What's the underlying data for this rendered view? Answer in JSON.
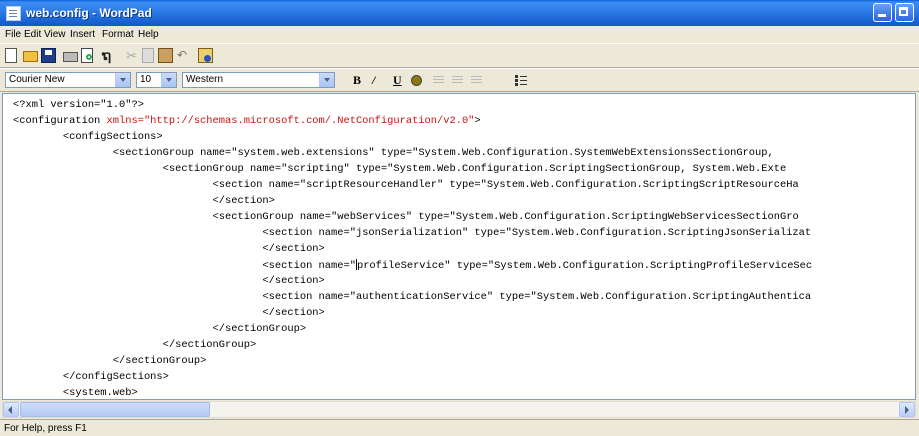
{
  "window": {
    "title": "web.config - WordPad"
  },
  "menu": [
    "File",
    "Edit",
    "View",
    "Insert",
    "Format",
    "Help"
  ],
  "toolbar": {
    "icons": [
      "new-document-icon",
      "open-folder-icon",
      "save-disk-icon",
      "print-icon",
      "print-preview-icon",
      "find-binoculars-icon",
      "cut-scissors-icon",
      "copy-icon",
      "paste-icon",
      "undo-icon",
      "date-time-icon"
    ],
    "find_glyph": "ຖ",
    "cut_glyph": "✂",
    "undo_glyph": "↶"
  },
  "format": {
    "font": "Courier New",
    "size": "10",
    "script": "Western",
    "bold": "B",
    "italic": "/",
    "underline": "U"
  },
  "document": {
    "lines": [
      {
        "indent": "",
        "pre": "<?xml version=\"1.0\"?>",
        "attr": "",
        "post": ""
      },
      {
        "indent": "",
        "pre": "<configuration ",
        "attr": "xmlns=\"http://schemas.microsoft.com/.NetConfiguration/v2.0\"",
        "post": ">"
      },
      {
        "indent": "        ",
        "pre": "<configSections>",
        "attr": "",
        "post": ""
      },
      {
        "indent": "                ",
        "pre": "<sectionGroup name=\"system.web.extensions\" type=\"System.Web.Configuration.SystemWebExtensionsSectionGroup,",
        "attr": "",
        "post": ""
      },
      {
        "indent": "                        ",
        "pre": "<sectionGroup name=\"scripting\" type=\"System.Web.Configuration.ScriptingSectionGroup, System.Web.Exte",
        "attr": "",
        "post": ""
      },
      {
        "indent": "                                ",
        "pre": "<section name=\"scriptResourceHandler\" type=\"System.Web.Configuration.ScriptingScriptResourceHa",
        "attr": "",
        "post": ""
      },
      {
        "indent": "                                ",
        "pre": "</section>",
        "attr": "",
        "post": ""
      },
      {
        "indent": "                                ",
        "pre": "<sectionGroup name=\"webServices\" type=\"System.Web.Configuration.ScriptingWebServicesSectionGro",
        "attr": "",
        "post": ""
      },
      {
        "indent": "                                        ",
        "pre": "<section name=\"jsonSerialization\" type=\"System.Web.Configuration.ScriptingJsonSerializat",
        "attr": "",
        "post": ""
      },
      {
        "indent": "                                        ",
        "pre": "</section>",
        "attr": "",
        "post": ""
      },
      {
        "indent": "                                        ",
        "pre": "<section name=\"",
        "attr": "",
        "post": "profileService\" type=\"System.Web.Configuration.ScriptingProfileServiceSec",
        "caret": true
      },
      {
        "indent": "                                        ",
        "pre": "</section>",
        "attr": "",
        "post": ""
      },
      {
        "indent": "                                        ",
        "pre": "<section name=\"authenticationService\" type=\"System.Web.Configuration.ScriptingAuthentica",
        "attr": "",
        "post": ""
      },
      {
        "indent": "                                        ",
        "pre": "</section>",
        "attr": "",
        "post": ""
      },
      {
        "indent": "                                ",
        "pre": "</sectionGroup>",
        "attr": "",
        "post": ""
      },
      {
        "indent": "                        ",
        "pre": "</sectionGroup>",
        "attr": "",
        "post": ""
      },
      {
        "indent": "                ",
        "pre": "</sectionGroup>",
        "attr": "",
        "post": ""
      },
      {
        "indent": "        ",
        "pre": "</configSections>",
        "attr": "",
        "post": ""
      },
      {
        "indent": "        ",
        "pre": "<system.web>",
        "attr": "",
        "post": ""
      }
    ]
  },
  "status": {
    "text": "For Help, press F1"
  },
  "colors": {
    "titlebar": "#2f7ee8",
    "xml_attribute": "#cc1111",
    "chrome": "#ece9d8"
  }
}
